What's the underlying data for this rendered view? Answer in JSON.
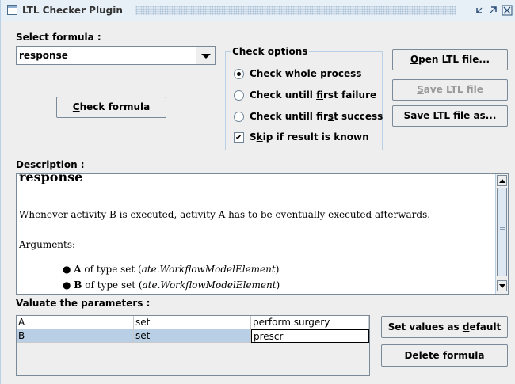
{
  "window": {
    "title": "LTL Checker Plugin",
    "icon": "window-icon",
    "controls": [
      "minimize-icon",
      "maximize-icon",
      "close-icon"
    ]
  },
  "formula": {
    "label": "Select formula :",
    "selected": "response"
  },
  "check_formula_button": {
    "label_prefix": "",
    "mnemonic": "C",
    "label_rest": "heck formula"
  },
  "check_options": {
    "legend": "Check options",
    "items": [
      {
        "pre": "Check ",
        "mn": "w",
        "post": "hole process",
        "checked": true
      },
      {
        "pre": "Check untill ",
        "mn": "f",
        "post": "irst failure",
        "checked": false
      },
      {
        "pre": "Check untill fir",
        "mn": "s",
        "post": "t success",
        "checked": false
      }
    ],
    "skip": {
      "pre": "S",
      "mn": "k",
      "post": "ip if result is known",
      "checked": true
    }
  },
  "file_buttons": {
    "open": {
      "pre": "",
      "mn": "O",
      "post": "pen LTL file...",
      "enabled": true
    },
    "save": {
      "pre": "",
      "mn": "S",
      "post": "ave LTL file",
      "enabled": false
    },
    "save_as": {
      "pre": "Save LTL file as...",
      "mn": "",
      "post": "",
      "enabled": true
    }
  },
  "description": {
    "label": "Description :",
    "heading": "response",
    "text": "Whenever activity B is executed, activity A has to be eventually executed afterwards.",
    "arguments_label": "Arguments:",
    "arguments": [
      {
        "name": "A",
        "type_text": " of type set (",
        "type_name": "ate.WorkflowModelElement",
        "close": ")"
      },
      {
        "name": "B",
        "type_text": " of type set (",
        "type_name": "ate.WorkflowModelElement",
        "close": ")"
      }
    ]
  },
  "parameters": {
    "label": "Valuate the parameters :",
    "rows": [
      {
        "name": "A",
        "type": "set",
        "value": "perform surgery"
      },
      {
        "name": "B",
        "type": "set",
        "value": "prescr"
      }
    ]
  },
  "param_buttons": {
    "set_default": {
      "pre": "Set values as ",
      "mn": "d",
      "post": "efault"
    },
    "delete": {
      "label": "Delete formula"
    }
  },
  "colors": {
    "accent": "#b8cfe5",
    "selection": "#b8cfe5"
  }
}
